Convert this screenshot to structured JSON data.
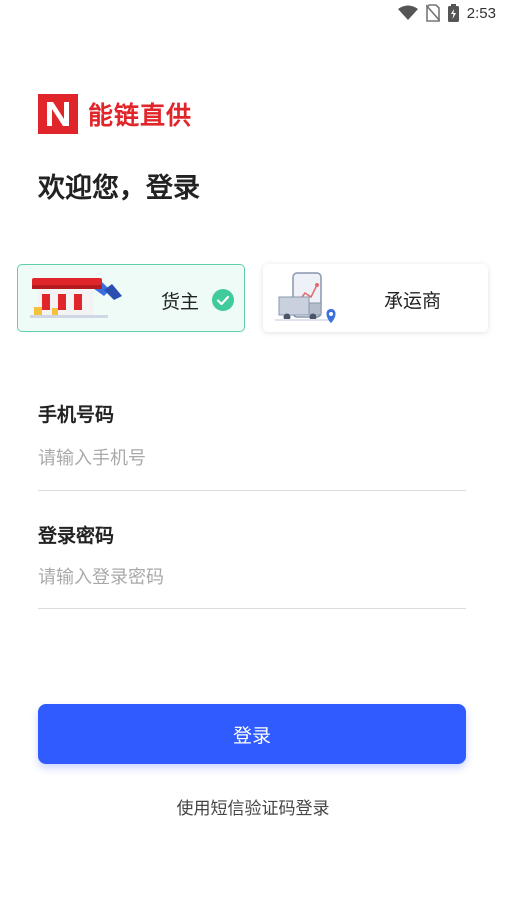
{
  "status_bar": {
    "time": "2:53",
    "icons": [
      "wifi-icon",
      "no-sim-icon",
      "battery-charging-icon"
    ]
  },
  "logo": {
    "text": "能链直供",
    "brand_color": "#e0262b"
  },
  "welcome": "欢迎您，登录",
  "roles": {
    "shipper": {
      "label": "货主",
      "selected": true,
      "icon": "gas-station-illustration"
    },
    "carrier": {
      "label": "承运商",
      "selected": false,
      "icon": "truck-phone-illustration"
    }
  },
  "form": {
    "phone": {
      "label": "手机号码",
      "placeholder": "请输入手机号",
      "value": ""
    },
    "password": {
      "label": "登录密码",
      "placeholder": "请输入登录密码",
      "value": ""
    }
  },
  "login_button": "登录",
  "sms_login_link": "使用短信验证码登录",
  "colors": {
    "primary": "#2f5bff",
    "selected_border": "#5fd0ab",
    "check": "#3fcb9a"
  }
}
